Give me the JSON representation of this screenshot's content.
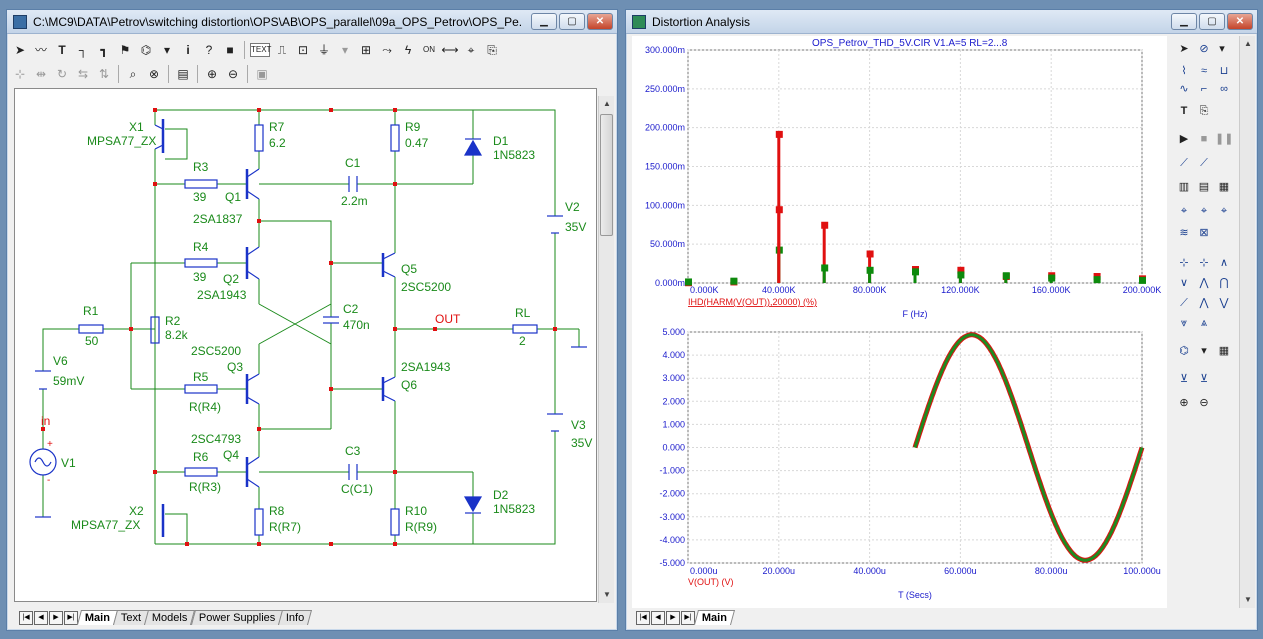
{
  "schematic_window": {
    "title": "C:\\MC9\\DATA\\Petrov\\switching distortion\\OPS\\AB\\OPS_parallel\\09a_OPS_Petrov\\OPS_Pe...",
    "tabs": [
      "Main",
      "Text",
      "Models",
      "Power Supplies",
      "Info"
    ],
    "active_tab": "Main",
    "components": {
      "X1": {
        "ref": "X1",
        "model": "MPSA77_ZX"
      },
      "X2": {
        "ref": "X2",
        "model": "MPSA77_ZX"
      },
      "R1": {
        "ref": "R1",
        "value": "50"
      },
      "R2": {
        "ref": "R2",
        "value": "8.2k"
      },
      "R3": {
        "ref": "R3",
        "value": "39"
      },
      "R4": {
        "ref": "R4",
        "value": "39"
      },
      "R5": {
        "ref": "R5",
        "value": "R(R4)"
      },
      "R6": {
        "ref": "R6",
        "value": "R(R3)"
      },
      "R7": {
        "ref": "R7",
        "value": "6.2"
      },
      "R8": {
        "ref": "R8",
        "value": "R(R7)"
      },
      "R9": {
        "ref": "R9",
        "value": "0.47"
      },
      "R10": {
        "ref": "R10",
        "value": "R(R9)"
      },
      "RL": {
        "ref": "RL",
        "value": "2"
      },
      "C1": {
        "ref": "C1",
        "value": "2.2m"
      },
      "C2": {
        "ref": "C2",
        "value": "470n"
      },
      "C3": {
        "ref": "C3",
        "value": "C(C1)"
      },
      "D1": {
        "ref": "D1",
        "model": "1N5823"
      },
      "D2": {
        "ref": "D2",
        "model": "1N5823"
      },
      "Q1": {
        "ref": "Q1",
        "model": "2SA1837"
      },
      "Q2": {
        "ref": "Q2",
        "model": "2SA1943"
      },
      "Q3": {
        "ref": "Q3",
        "model": "2SC5200"
      },
      "Q4": {
        "ref": "Q4",
        "model": "2SC4793"
      },
      "Q5": {
        "ref": "Q5",
        "model": "2SC5200"
      },
      "Q6": {
        "ref": "Q6",
        "model": "2SA1943"
      },
      "V1": {
        "ref": "V1"
      },
      "V2": {
        "ref": "V2",
        "value": "35V"
      },
      "V3": {
        "ref": "V3",
        "value": "35V"
      },
      "V6": {
        "ref": "V6",
        "value": "59mV"
      }
    },
    "node_labels": {
      "out": "OUT",
      "in": "in",
      "plus": "+",
      "minus": "-"
    }
  },
  "analysis_window": {
    "title": "Distortion Analysis",
    "header": "OPS_Petrov_THD_5V.CIR V1.A=5 RL=2...8",
    "tabs": [
      "Main"
    ],
    "active_tab": "Main"
  },
  "chart_data": [
    {
      "type": "bar",
      "ylabel": "IHD(HARM(V(OUT)),20000) (%)",
      "xlabel": "F (Hz)",
      "xlim": [
        0,
        200000
      ],
      "ylim": [
        0,
        0.3
      ],
      "x_ticks": [
        "0.000K",
        "40.000K",
        "80.000K",
        "120.000K",
        "160.000K",
        "200.000K"
      ],
      "y_ticks": [
        "0.000m",
        "50.000m",
        "100.000m",
        "150.000m",
        "200.000m",
        "250.000m",
        "300.000m"
      ],
      "series": [
        {
          "color": "#e01010",
          "x": [
            0,
            20000,
            40000,
            60000,
            80000,
            100000,
            120000,
            140000,
            160000,
            180000,
            200000
          ],
          "values": [
            0.001,
            0.002,
            0.192,
            0.075,
            0.038,
            0.018,
            0.017,
            0.009,
            0.01,
            0.009,
            0.006
          ]
        },
        {
          "color": "#0d8a0d",
          "x": [
            0,
            20000,
            40000,
            60000,
            80000,
            100000,
            120000,
            140000,
            160000,
            180000,
            200000
          ],
          "values": [
            0.002,
            0.003,
            0.043,
            0.02,
            0.017,
            0.015,
            0.011,
            0.01,
            0.007,
            0.005,
            0.004
          ]
        },
        {
          "color": "#e01010",
          "x": [
            40000
          ],
          "values": [
            0.095
          ]
        }
      ],
      "grid": true
    },
    {
      "type": "line",
      "ylabel": "V(OUT) (V)",
      "xlabel": "T (Secs)",
      "xlim": [
        0,
        0.0001
      ],
      "ylim": [
        -5,
        5
      ],
      "x_ticks": [
        "0.000u",
        "20.000u",
        "40.000u",
        "60.000u",
        "80.000u",
        "100.000u"
      ],
      "y_ticks": [
        "5.000",
        "4.000",
        "3.000",
        "2.000",
        "1.000",
        "0.000",
        "-1.000",
        "-2.000",
        "-3.000",
        "-4.000",
        "-5.000"
      ],
      "series": [
        {
          "color": "#e01010",
          "t_start": 5e-05,
          "t_end": 0.0001,
          "amplitude": 4.88,
          "frequency": 20000
        },
        {
          "color": "#1f8a1f",
          "t_start": 5e-05,
          "t_end": 0.0001,
          "amplitude": 4.88,
          "frequency": 20000
        }
      ],
      "grid": true
    }
  ],
  "colors": {
    "schematic_wire": "#1a8a1a",
    "component": "#1a33c8",
    "node_dot": "#e01010",
    "label": "#1a8a1a",
    "plot_text": "#1a1acc"
  }
}
